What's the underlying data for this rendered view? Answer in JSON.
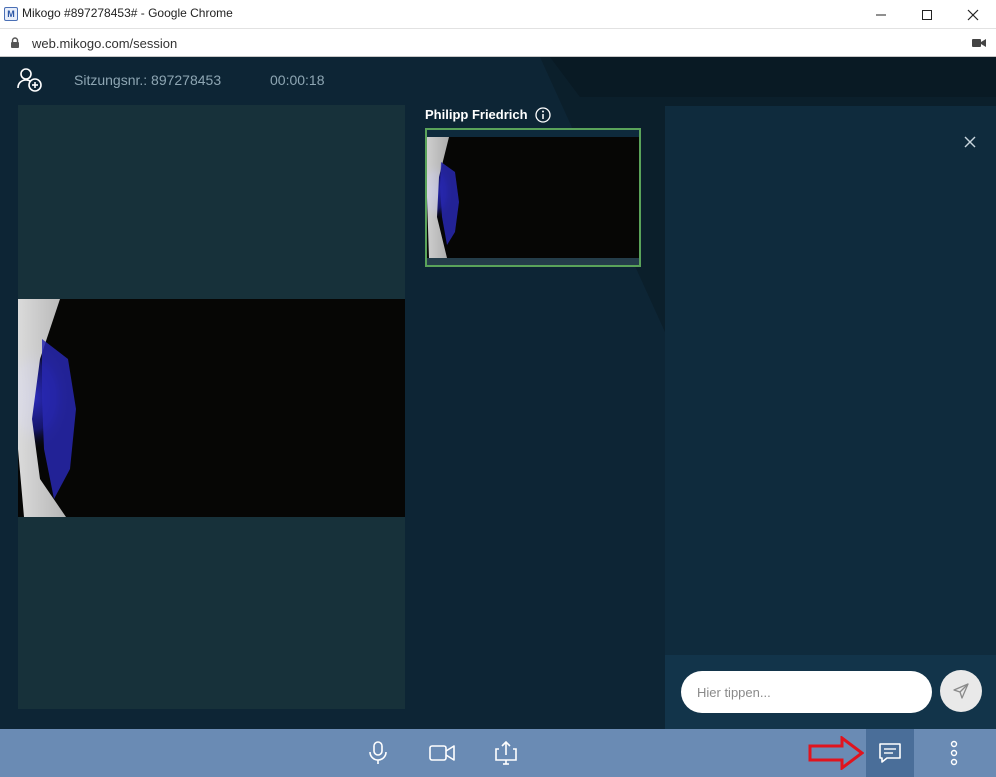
{
  "browser": {
    "window_title": "Mikogo #897278453# - Google Chrome",
    "favicon_letter": "M",
    "url": "web.mikogo.com/session"
  },
  "topbar": {
    "session_label": "Sitzungsnr.: 897278453",
    "timer": "00:00:18"
  },
  "participant": {
    "name": "Philipp Friedrich"
  },
  "chat": {
    "input_placeholder": "Hier tippen..."
  },
  "colors": {
    "app_background": "#0d2535",
    "toolbar": "#6a8bb4",
    "active_button": "#4a6e99",
    "thumb_border": "#5aa35a",
    "annotation_arrow": "#e0141e"
  }
}
